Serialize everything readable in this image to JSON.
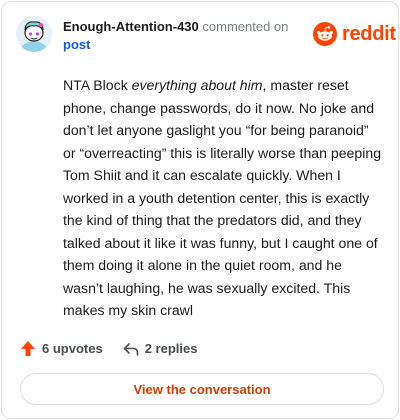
{
  "header": {
    "author": "Enough-Attention-430",
    "action": "commented on",
    "target": "post"
  },
  "logo": {
    "icon": "reddit-alien-icon",
    "word": "reddit",
    "color": "#ff4500"
  },
  "comment": {
    "p1": "NTA Block ",
    "em": "everything about him",
    "p2": ", master reset phone, change passwords, do it now. No joke and don’t let anyone gaslight you “for being paranoid” or “overreacting” this is literally worse than peeping Tom Shiit and it can escalate quickly. When I worked in a youth detention center, this is exactly the kind of thing that the predators did, and they talked about it like it was funny, but I caught one of them doing it alone in the quiet room, and he wasn’t laughing, he was sexually excited. This makes my skin crawl"
  },
  "actions": {
    "upvotes_icon": "upvote-arrow-icon",
    "upvotes": "6 upvotes",
    "replies_icon": "reply-arrow-icon",
    "replies": "2 replies"
  },
  "view_button": "View the conversation"
}
